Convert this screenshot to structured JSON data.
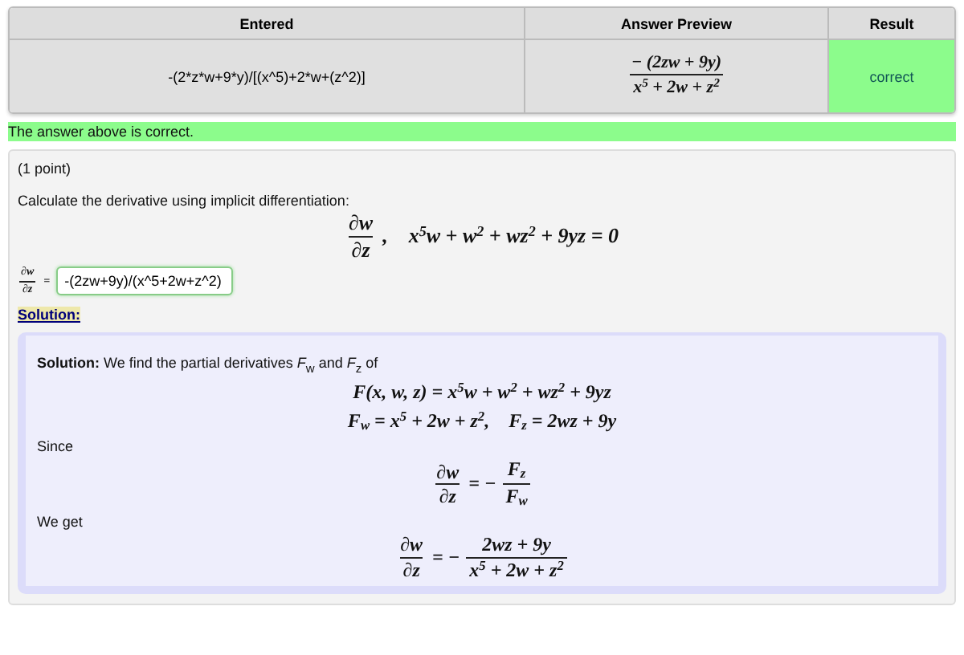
{
  "results_table": {
    "columns": [
      "Entered",
      "Answer Preview",
      "Result"
    ],
    "rows": [
      {
        "entered": "-(2*z*w+9*y)/[(x^5)+2*w+(z^2)]",
        "preview": [
          {
            "kind": "frac",
            "num": "− (2zw + 9y)",
            "den": "x$^{5}$ + 2w + z$^{2}$"
          }
        ],
        "result": "correct",
        "correct": true
      }
    ]
  },
  "message": {
    "text": "The answer above is correct.",
    "correct": true
  },
  "problem": {
    "points": "(1 point)",
    "prompt": "Calculate the derivative using implicit differentiation:",
    "question_formula": [
      {
        "kind": "frac",
        "num": "∂w",
        "den": "∂z"
      },
      {
        "kind": "text",
        "text": ",    x$^{5}$w + w$^{2}$ + wz$^{2}$ + 9yz = 0"
      }
    ],
    "answer_label": [
      {
        "kind": "frac",
        "num": "∂w",
        "den": "∂z"
      },
      {
        "kind": "text",
        "text": "="
      }
    ],
    "answer": {
      "value": "-(2zw+9y)/(x^5+2w+z^2)",
      "correct": true
    },
    "solution_link": "Solution:",
    "solution": [
      {
        "kind": "paragraph",
        "text": "**Solution:** We find the partial derivatives *F*$_{w}$ and *F*$_{z}$ of"
      },
      {
        "kind": "formula",
        "parts": [
          {
            "kind": "text",
            "text": "F(x, w, z) = x$^{5}$w + w$^{2}$ + wz$^{2}$ + 9yz"
          }
        ]
      },
      {
        "kind": "formula",
        "parts": [
          {
            "kind": "text",
            "text": "F$_{w}$ = x$^{5}$ + 2w + z$^{2}$,    F$_{z}$ = 2wz + 9y"
          }
        ]
      },
      {
        "kind": "paragraph",
        "text": "Since"
      },
      {
        "kind": "formula",
        "parts": [
          {
            "kind": "frac",
            "num": "∂w",
            "den": "∂z"
          },
          {
            "kind": "text",
            "text": "= −"
          },
          {
            "kind": "frac",
            "num": "F$_{z}$",
            "den": "F$_{w}$"
          }
        ]
      },
      {
        "kind": "paragraph",
        "text": "We get"
      },
      {
        "kind": "formula",
        "parts": [
          {
            "kind": "frac",
            "num": "∂w",
            "den": "∂z"
          },
          {
            "kind": "text",
            "text": "= −"
          },
          {
            "kind": "frac",
            "num": "2wz + 9y",
            "den": "x$^{5}$ + 2w + z$^{2}$"
          }
        ]
      }
    ]
  }
}
